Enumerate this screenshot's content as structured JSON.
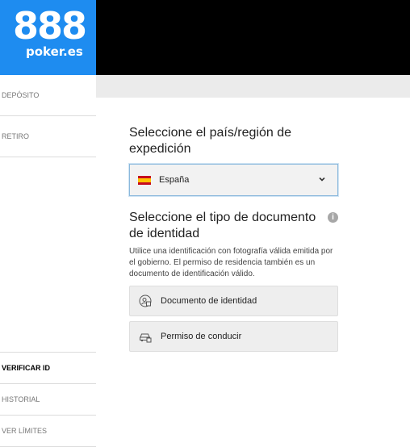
{
  "brand": {
    "logo_number": "888",
    "logo_sub": "poker.es"
  },
  "sidebar": {
    "items": [
      {
        "label": "DEPÓSITO"
      },
      {
        "label": "RETIRO"
      },
      {
        "label": "VERIFICAR ID"
      },
      {
        "label": "HISTORIAL"
      },
      {
        "label": "VER LÍMITES"
      }
    ],
    "active_item": "VERIFICAR ID"
  },
  "country": {
    "heading": "Seleccione el país/región de expedición",
    "selected_value": "España",
    "flag": "spain-flag-icon"
  },
  "document": {
    "heading": "Seleccione el tipo de documento de identidad",
    "description": "Utilice una identificación con fotografía válida emitida por el gobierno. El permiso de residencia también es un documento de identificación válido.",
    "options": [
      {
        "label": "Documento de identidad",
        "icon": "id-card-icon"
      },
      {
        "label": "Permiso de conducir",
        "icon": "car-icon"
      }
    ]
  },
  "colors": {
    "brand_blue": "#1e8cf0",
    "topbar": "#000000"
  }
}
